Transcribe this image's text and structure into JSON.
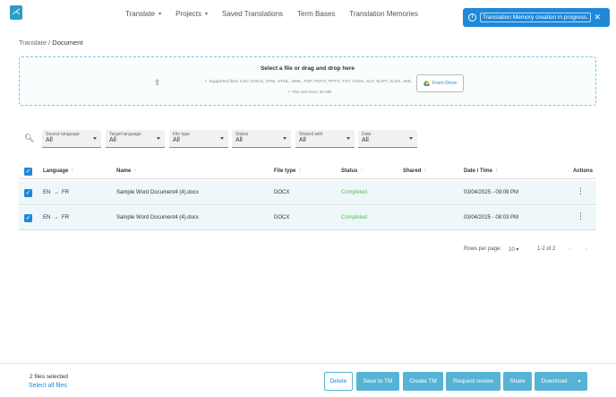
{
  "nav": {
    "items": [
      {
        "label": "Translate",
        "dropdown": true
      },
      {
        "label": "Projects",
        "dropdown": true
      },
      {
        "label": "Saved Translations",
        "dropdown": false
      },
      {
        "label": "Term Bases",
        "dropdown": false
      },
      {
        "label": "Translation Memories",
        "dropdown": false
      }
    ]
  },
  "toast": {
    "message": "Translation Memory creation in progress.",
    "close": "✕",
    "color": "#1e88d9"
  },
  "breadcrumb": {
    "parent": "Translate",
    "separator": "/",
    "current": "Document"
  },
  "dropzone": {
    "title": "Select a file or drag and drop here",
    "supported": "Supported files: CSV, DOCX, HTM, HTML, IDML, PDF, POTX, PPTX, TXT, VSDX, XLF, XLIFF, XLSX, XML",
    "limit": "File size limit: 20 MB",
    "drive_button": "From Drive"
  },
  "filters": [
    {
      "label": "Source language",
      "value": "All"
    },
    {
      "label": "Target language",
      "value": "All"
    },
    {
      "label": "File type",
      "value": "All"
    },
    {
      "label": "Status",
      "value": "All"
    },
    {
      "label": "Shared with",
      "value": "All"
    },
    {
      "label": "Date",
      "value": "All"
    }
  ],
  "table": {
    "columns": [
      "Language",
      "Name",
      "File type",
      "Status",
      "Shared",
      "Date / Time",
      "Actions"
    ],
    "rows": [
      {
        "source": "EN",
        "target": "FR",
        "name": "Sample Word Document4 (4).docx",
        "type": "DOCX",
        "status": "Completed",
        "shared": "",
        "datetime": "03/04/2025 - 09:09 PM",
        "checked": true
      },
      {
        "source": "EN",
        "target": "FR",
        "name": "Sample Word Document4 (4).docx",
        "type": "DOCX",
        "status": "Completed",
        "shared": "",
        "datetime": "03/04/2025 - 08:03 PM",
        "checked": true
      }
    ]
  },
  "pagination": {
    "rows_label": "Rows per page:",
    "rows_value": "10",
    "range": "1-2 of 2"
  },
  "footer": {
    "selected": "2 files selected",
    "select_all": "Select all files",
    "buttons": {
      "delete": "Delete",
      "save_tm": "Save to TM",
      "create_tm": "Create TM",
      "review": "Request review",
      "share": "Share",
      "download": "Download"
    }
  },
  "colors": {
    "accent": "#1e88d9",
    "button": "#56b3d6",
    "completed": "#5cb85c",
    "row_bg": "#eef7f9"
  }
}
